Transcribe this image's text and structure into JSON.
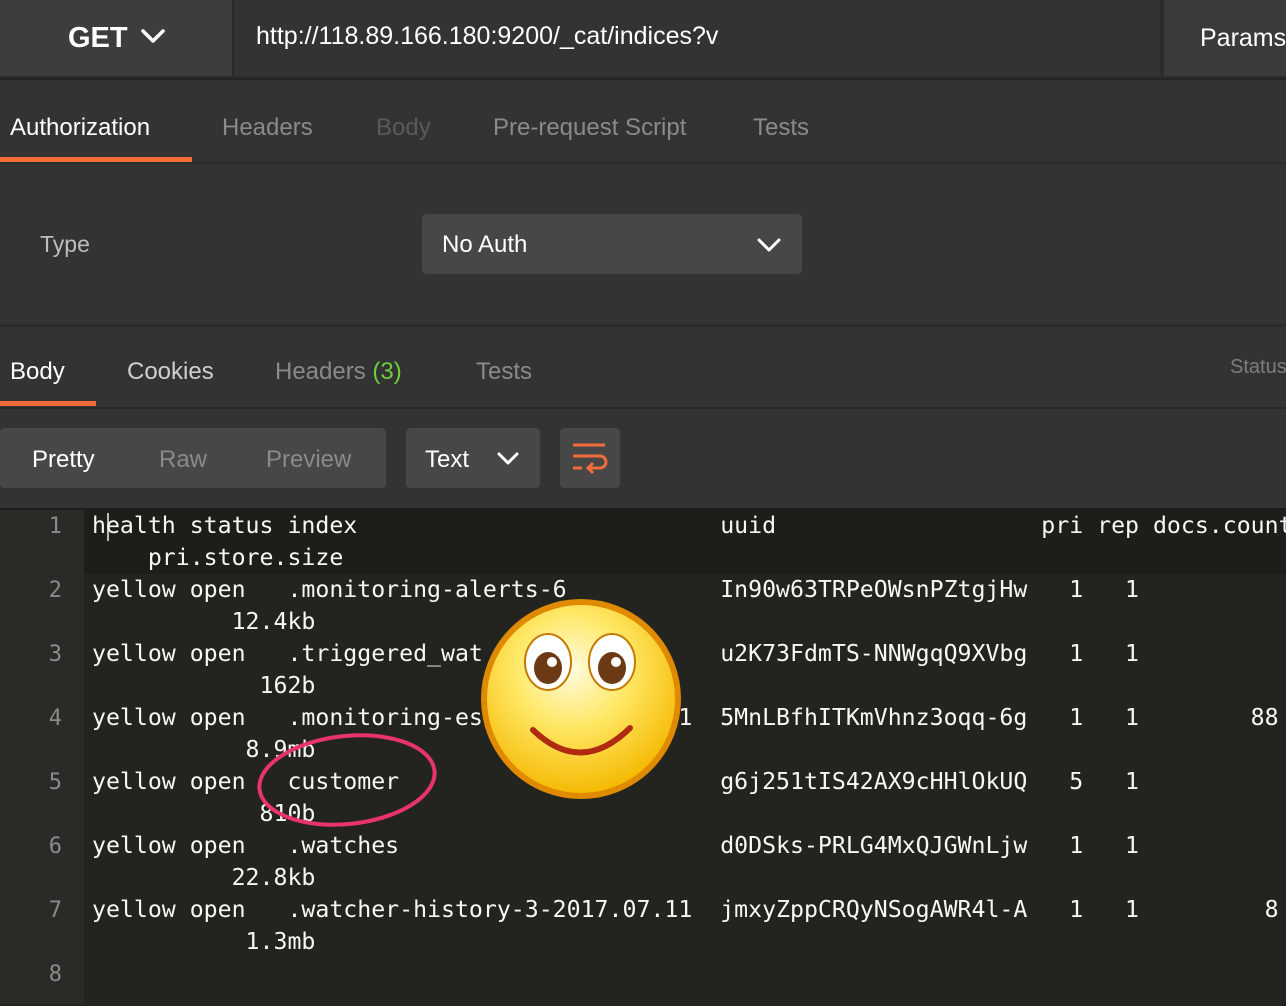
{
  "request": {
    "method": "GET",
    "url": "http://118.89.166.180:9200/_cat/indices?v",
    "params_label": "Params"
  },
  "request_tabs": {
    "authorization": "Authorization",
    "headers": "Headers",
    "body": "Body",
    "prerequest": "Pre-request Script",
    "tests": "Tests"
  },
  "auth": {
    "type_label": "Type",
    "selected": "No Auth"
  },
  "response_tabs": {
    "body": "Body",
    "cookies": "Cookies",
    "headers": "Headers",
    "headers_count": "(3)",
    "tests": "Tests",
    "status": "Status"
  },
  "toolbar": {
    "pretty": "Pretty",
    "raw": "Raw",
    "preview": "Preview",
    "format": "Text"
  },
  "lines": [
    {
      "num": "1",
      "text": "health status index                          uuid                   pri rep docs.count",
      "cont": "    pri.store.size"
    },
    {
      "num": "2",
      "text": "yellow open   .monitoring-alerts-6           In90w63TRPeOWsnPZtgjHw   1   1",
      "cont": "          12.4kb"
    },
    {
      "num": "3",
      "text": "yellow open   .triggered_wat                 u2K73FdmTS-NNWgqQ9XVbg   1   1",
      "cont": "            162b"
    },
    {
      "num": "4",
      "text": "yellow open   .monitoring-es              1  5MnLBfhITKmVhnz3oqq-6g   1   1        88",
      "cont": "           8.9mb"
    },
    {
      "num": "5",
      "text": "yellow open   customer                       g6j251tIS42AX9cHHlOkUQ   5   1",
      "cont": "            810b"
    },
    {
      "num": "6",
      "text": "yellow open   .watches                       d0DSks-PRLG4MxQJGWnLjw   1   1",
      "cont": "          22.8kb"
    },
    {
      "num": "7",
      "text": "yellow open   .watcher-history-3-2017.07.11  jmxyZppCRQyNSogAWR4l-A   1   1         8",
      "cont": "           1.3mb"
    },
    {
      "num": "8",
      "text": "",
      "cont": ""
    }
  ],
  "colors": {
    "accent": "#f26b3a",
    "green": "#6fcf3d",
    "annotation_circle": "#e8336d"
  },
  "icons": [
    "chevron-down-icon",
    "wrap-lines-icon",
    "smiley-face-icon"
  ]
}
